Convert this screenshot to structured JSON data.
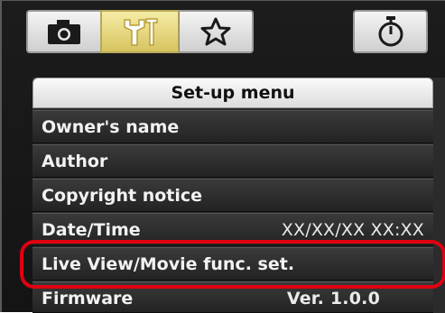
{
  "tabs": [
    {
      "icon": "camera-icon"
    },
    {
      "icon": "setup-tools-icon",
      "active": true
    },
    {
      "icon": "star-icon"
    },
    {
      "icon": "timer-icon"
    }
  ],
  "menu": {
    "title": "Set-up menu",
    "items": [
      {
        "label": "Owner's name",
        "value": ""
      },
      {
        "label": "Author",
        "value": ""
      },
      {
        "label": "Copyright notice",
        "value": ""
      },
      {
        "label": "Date/Time",
        "value": "XX/XX/XX XX:XX"
      },
      {
        "label": "Live View/Movie func. set.",
        "value": "",
        "highlighted": true
      },
      {
        "label": "Firmware",
        "value": "Ver. 1.0.0"
      }
    ]
  },
  "colors": {
    "active_tab": "#e3d57e",
    "highlight_outline": "#e00010",
    "menu_background": "#2b2b2b"
  }
}
